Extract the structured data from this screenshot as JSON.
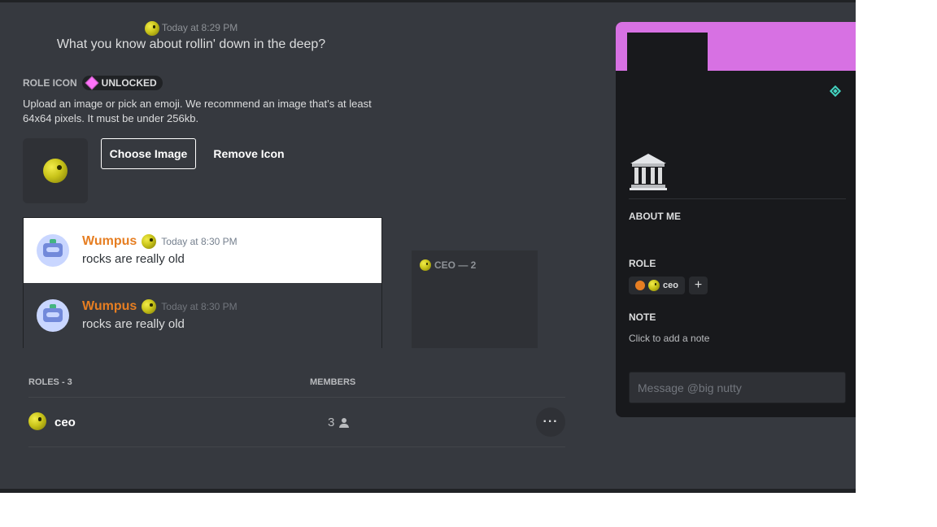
{
  "top_message": {
    "timestamp": "Today at 8:29 PM",
    "text": "What you know about rollin' down in the deep?"
  },
  "role_icon": {
    "title": "ROLE ICON",
    "badge": "UNLOCKED",
    "help_text": "Upload an image or pick an emoji. We recommend an image that’s at least 64x64 pixels. It must be under 256kb.",
    "choose_label": "Choose Image",
    "remove_label": "Remove Icon"
  },
  "preview_messages": [
    {
      "author": "Wumpus",
      "timestamp": "Today at 8:30 PM",
      "text": "rocks are really old",
      "theme": "light"
    },
    {
      "author": "Wumpus",
      "timestamp": "Today at 8:30 PM",
      "text": "rocks are really old",
      "theme": "dark"
    }
  ],
  "member_list": {
    "group_label": "CEO — 2"
  },
  "roles_table": {
    "roles_header": "ROLES - 3",
    "members_header": "MEMBERS",
    "rows": [
      {
        "name": "ceo",
        "members": "3"
      }
    ],
    "more_label": "···"
  },
  "profile": {
    "about_title": "ABOUT ME",
    "role_title": "ROLE",
    "role_name": "ceo",
    "add_role_label": "+",
    "note_title": "NOTE",
    "note_placeholder": "Click to add a note",
    "message_placeholder": "Message @big nutty"
  },
  "colors": {
    "background": "#36393f",
    "banner": "#d771e3",
    "role_color": "#e67e22",
    "nitro": "#43d3c0",
    "gem": "#ff73fa"
  },
  "icons": [
    "emoji-icon",
    "gem-icon",
    "person-icon",
    "nitro-badge-icon",
    "bank-icon",
    "more-icon",
    "plus-icon"
  ]
}
